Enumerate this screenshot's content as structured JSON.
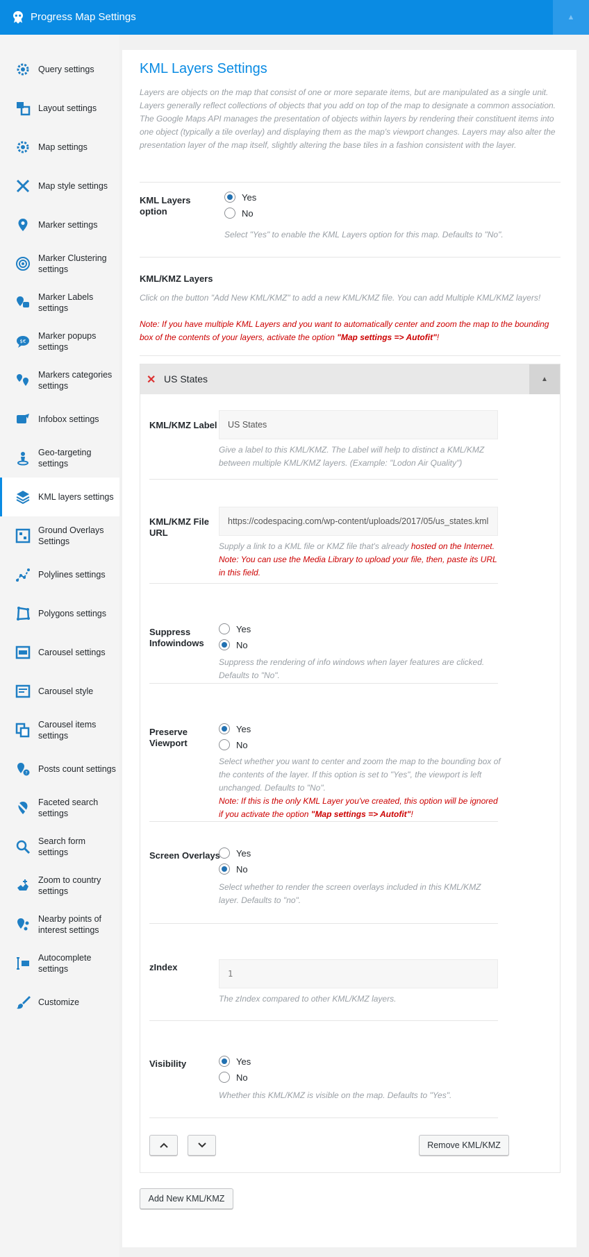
{
  "header": {
    "title": "Progress Map Settings",
    "collapse_glyph": "▲"
  },
  "sidebar": {
    "items": [
      {
        "label": "Query settings",
        "icon": "gear-icon"
      },
      {
        "label": "Layout settings",
        "icon": "layout-icon"
      },
      {
        "label": "Map settings",
        "icon": "gear-icon"
      },
      {
        "label": "Map style settings",
        "icon": "pencil-ruler-icon"
      },
      {
        "label": "Marker settings",
        "icon": "marker-icon"
      },
      {
        "label": "Marker Clustering settings",
        "icon": "cluster-icon"
      },
      {
        "label": "Marker Labels settings",
        "icon": "marker-labels-icon"
      },
      {
        "label": "Marker popups settings",
        "icon": "popup-icon"
      },
      {
        "label": "Markers categories settings",
        "icon": "categories-icon"
      },
      {
        "label": "Infobox settings",
        "icon": "infobox-icon"
      },
      {
        "label": "Geo-targeting settings",
        "icon": "geo-targeting-icon"
      },
      {
        "label": "KML layers settings",
        "icon": "layers-icon"
      },
      {
        "label": "Ground Overlays Settings",
        "icon": "ground-overlay-icon"
      },
      {
        "label": "Polylines settings",
        "icon": "polyline-icon"
      },
      {
        "label": "Polygons settings",
        "icon": "polygon-icon"
      },
      {
        "label": "Carousel settings",
        "icon": "carousel-icon"
      },
      {
        "label": "Carousel style",
        "icon": "carousel-style-icon"
      },
      {
        "label": "Carousel items settings",
        "icon": "carousel-items-icon"
      },
      {
        "label": "Posts count settings",
        "icon": "posts-count-icon"
      },
      {
        "label": "Faceted search settings",
        "icon": "faceted-search-icon"
      },
      {
        "label": "Search form settings",
        "icon": "search-icon"
      },
      {
        "label": "Zoom to country settings",
        "icon": "zoom-country-icon"
      },
      {
        "label": "Nearby points of interest settings",
        "icon": "nearby-poi-icon"
      },
      {
        "label": "Autocomplete settings",
        "icon": "autocomplete-icon"
      },
      {
        "label": "Customize",
        "icon": "brush-icon"
      }
    ],
    "active_index": 11
  },
  "main": {
    "title": "KML Layers Settings",
    "intro": "Layers are objects on the map that consist of one or more separate items, but are manipulated as a single unit. Layers generally reflect collections of objects that you add on top of the map to designate a common association. The Google Maps API manages the presentation of objects within layers by rendering their constituent items into one object (typically a tile overlay) and displaying them as the map's viewport changes. Layers may also alter the presentation layer of the map itself, slightly altering the base tiles in a fashion consistent with the layer.",
    "kml_option": {
      "label": "KML Layers option",
      "yes": "Yes",
      "no": "No",
      "selected": "Yes",
      "help": "Select \"Yes\" to enable the KML Layers option for this map. Defaults to \"No\"."
    },
    "kml_layers": {
      "heading": "KML/KMZ Layers",
      "help": "Click on the button \"Add New KML/KMZ\" to add a new KML/KMZ file. You can add Multiple KML/KMZ layers!",
      "note_prefix": "Note: If you have multiple KML Layers and you want to automatically center and zoom the map to the bounding box of the contents of your layers, activate the option ",
      "note_bold": "\"Map settings => Autofit\"",
      "note_suffix": "!"
    },
    "layer": {
      "name": "US States",
      "remove_glyph": "✕",
      "toggle_glyph": "▲",
      "label_field": {
        "label": "KML/KMZ Label",
        "value": "US States",
        "help": "Give a label to this KML/KMZ. The Label will help to distinct a KML/KMZ between multiple KML/KMZ layers. (Example: \"Lodon Air Quality\")"
      },
      "url_field": {
        "label": "KML/KMZ File URL",
        "value": "https://codespacing.com/wp-content/uploads/2017/05/us_states.kml",
        "help_prefix": "Supply a link to a KML file or KMZ file that's already ",
        "help_red": "hosted on the Internet.",
        "note": "Note: You can use the Media Library to upload your file, then, paste its URL in this field."
      },
      "suppress": {
        "label": "Suppress Infowindows",
        "yes": "Yes",
        "no": "No",
        "selected": "No",
        "help": "Suppress the rendering of info windows when layer features are clicked. Defaults to \"No\"."
      },
      "preserve": {
        "label": "Preserve Viewport",
        "yes": "Yes",
        "no": "No",
        "selected": "Yes",
        "help": "Select whether you want to center and zoom the map to the bounding box of the contents of the layer. If this option is set to \"Yes\", the viewport is left unchanged. Defaults to \"No\".",
        "note_prefix": "Note: If this is the only KML Layer you've created, this option will be ignored if you activate the option ",
        "note_bold": "\"Map settings => Autofit\"",
        "note_suffix": "!"
      },
      "screen_overlays": {
        "label": "Screen Overlays",
        "yes": "Yes",
        "no": "No",
        "selected": "No",
        "help": "Select whether to render the screen overlays included in this KML/KMZ layer. Defaults to \"no\"."
      },
      "zindex": {
        "label": "zIndex",
        "value": "1",
        "help": "The zIndex compared to other KML/KMZ layers."
      },
      "visibility": {
        "label": "Visibility",
        "yes": "Yes",
        "no": "No",
        "selected": "Yes",
        "help": "Whether this KML/KMZ is visible on the map. Defaults to \"Yes\"."
      },
      "remove_button": "Remove KML/KMZ"
    },
    "add_button": "Add New KML/KMZ",
    "colors": {
      "brand": "#0a8be3",
      "note_red": "#cc0000",
      "radio_blue": "#2271b1"
    }
  }
}
